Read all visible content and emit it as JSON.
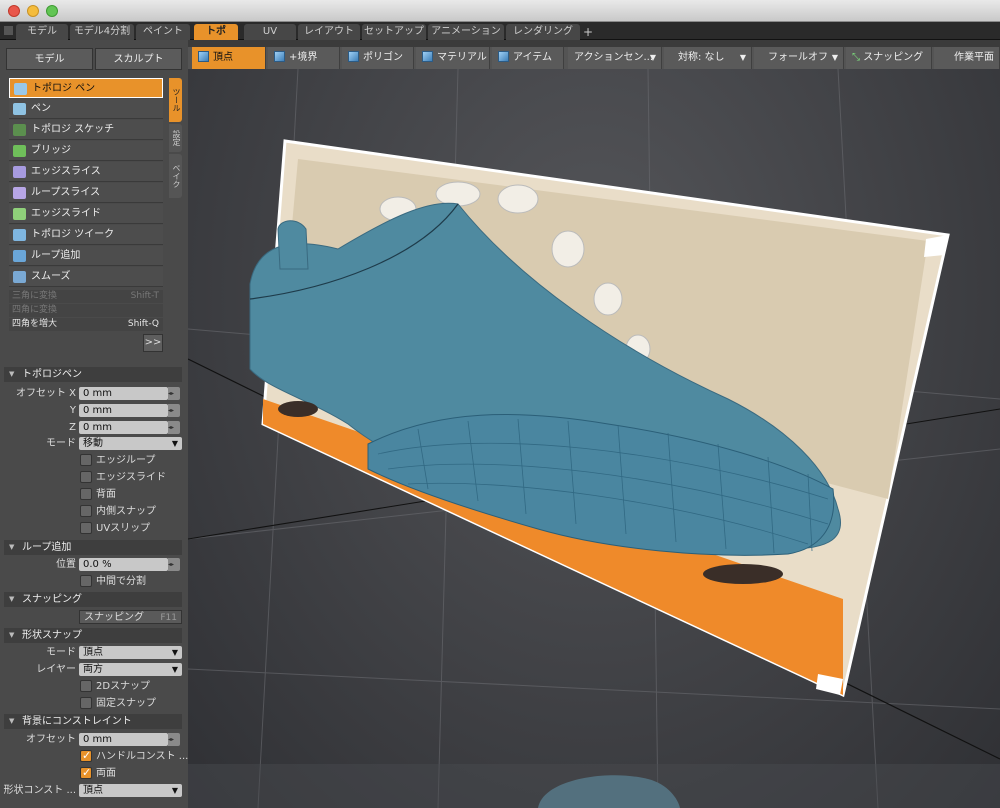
{
  "tabs": [
    {
      "label": "モデル"
    },
    {
      "label": "モデル4分割"
    },
    {
      "label": "ペイント"
    },
    {
      "label": "トポ",
      "active": true
    },
    {
      "label": "UV"
    },
    {
      "label": "レイアウト"
    },
    {
      "label": "セットアップ"
    },
    {
      "label": "アニメーション"
    },
    {
      "label": "レンダリング"
    }
  ],
  "tab_add": "+",
  "mode_buttons": {
    "model": "モデル",
    "sculpt": "スカルプト"
  },
  "toolbar": {
    "vertex": "頂点",
    "edge": "+境界",
    "polygon": "ポリゴン",
    "material": "マテリアル",
    "item": "アイテム",
    "action_center": "アクションセン...",
    "symmetry": "対称: なし",
    "falloff": "フォールオフ",
    "snapping": "スナッピング",
    "work_plane": "作業平面"
  },
  "side_tabs": [
    "ツール",
    "設定",
    "ベイク"
  ],
  "tools": [
    {
      "label": "トポロジ ペン",
      "active": true
    },
    {
      "label": "ペン"
    },
    {
      "label": "トポロジ スケッチ"
    },
    {
      "label": "ブリッジ"
    },
    {
      "label": "エッジスライス"
    },
    {
      "label": "ループスライス"
    },
    {
      "label": "エッジスライド"
    },
    {
      "label": "トポロジ ツイーク"
    },
    {
      "label": "ループ追加"
    },
    {
      "label": "スムーズ"
    }
  ],
  "commands": [
    {
      "label": "三角に変換",
      "shortcut": "Shift-T",
      "enabled": false
    },
    {
      "label": "四角に変換",
      "shortcut": "",
      "enabled": false
    },
    {
      "label": "四角を増大",
      "shortcut": "Shift-Q",
      "enabled": true
    }
  ],
  "expand_button": ">>",
  "properties": {
    "topo_pen": {
      "title": "トポロジペン",
      "offset_x_label": "オフセット X",
      "offset_x": "0 mm",
      "y_label": "Y",
      "y": "0 mm",
      "z_label": "Z",
      "z": "0 mm",
      "mode_label": "モード",
      "mode": "移動",
      "checks": [
        {
          "label": "エッジループ",
          "checked": false
        },
        {
          "label": "エッジスライド",
          "checked": false
        },
        {
          "label": "背面",
          "checked": false
        },
        {
          "label": "内側スナップ",
          "checked": false
        },
        {
          "label": "UVスリップ",
          "checked": false
        }
      ]
    },
    "loop_add": {
      "title": "ループ追加",
      "position_label": "位置",
      "position": "0.0 %",
      "split_middle": "中間で分割"
    },
    "snapping": {
      "title": "スナッピング",
      "button": "スナッピング",
      "key": "F11"
    },
    "shape_snap": {
      "title": "形状スナップ",
      "mode_label": "モード",
      "mode": "頂点",
      "layer_label": "レイヤー",
      "layer": "両方",
      "snap2d": "2Dスナップ",
      "fixed": "固定スナップ"
    },
    "bg_constraint": {
      "title": "背景にコンストレイント",
      "offset_label": "オフセット",
      "offset": "0 mm",
      "handle": "ハンドルコンスト ...",
      "both": "両面",
      "shape_label": "形状コンスト ...",
      "shape": "頂点"
    }
  },
  "colors": {
    "accent": "#e8922a",
    "mesh": "#4f8aa0",
    "bg_floor": "#ef8a2a"
  }
}
